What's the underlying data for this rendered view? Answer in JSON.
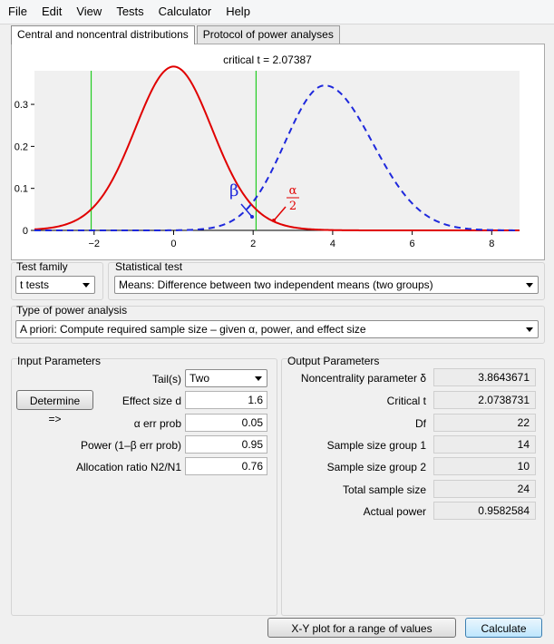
{
  "menu": [
    "File",
    "Edit",
    "View",
    "Tests",
    "Calculator",
    "Help"
  ],
  "tabs": {
    "central": "Central and noncentral distributions",
    "protocol": "Protocol of power analyses"
  },
  "chart_data": {
    "type": "line",
    "title": "critical t = 2.07387",
    "xlim": [
      -3.5,
      8.7
    ],
    "ylim": [
      0,
      0.38
    ],
    "x_ticks": [
      -2,
      0,
      2,
      4,
      6,
      8
    ],
    "y_ticks": [
      0,
      0.1,
      0.2,
      0.3
    ],
    "y_tick_labels": [
      "0",
      "0.1",
      "0.2",
      "0.3"
    ],
    "critical_lines": [
      -2.07387,
      2.07387
    ],
    "noncentrality": 3.8643671,
    "series": [
      {
        "style": "solid",
        "color": "#e00000",
        "peak": 0.39,
        "center": 0
      },
      {
        "style": "dashed",
        "color": "#1e28dc",
        "peak": 0.345,
        "center": 3.8
      }
    ],
    "annotations": {
      "beta": "β",
      "alpha_num": "α",
      "alpha_den": "2"
    },
    "colors": {
      "central": "#e00000",
      "noncentral": "#1e28dc",
      "critical": "#22cc22"
    }
  },
  "test_family": {
    "label": "Test family",
    "value": "t tests"
  },
  "statistical_test": {
    "label": "Statistical test",
    "value": "Means: Difference between two independent means (two groups)"
  },
  "power_analysis": {
    "label": "Type of power analysis",
    "value": "A priori: Compute required sample size – given α, power, and effect size"
  },
  "input": {
    "title": "Input Parameters",
    "tails_label": "Tail(s)",
    "tails_value": "Two",
    "determine": "Determine =>",
    "effect_label": "Effect size d",
    "effect_value": "1.6",
    "alpha_label": "α err prob",
    "alpha_value": "0.05",
    "power_label": "Power (1–β err prob)",
    "power_value": "0.95",
    "ratio_label": "Allocation ratio N2/N1",
    "ratio_value": "0.76"
  },
  "output": {
    "title": "Output Parameters",
    "rows": [
      {
        "label": "Noncentrality parameter δ",
        "value": "3.8643671"
      },
      {
        "label": "Critical t",
        "value": "2.0738731"
      },
      {
        "label": "Df",
        "value": "22"
      },
      {
        "label": "Sample size group 1",
        "value": "14"
      },
      {
        "label": "Sample size group 2",
        "value": "10"
      },
      {
        "label": "Total sample size",
        "value": "24"
      },
      {
        "label": "Actual power",
        "value": "0.9582584"
      }
    ]
  },
  "buttons": {
    "xy_plot": "X-Y plot for a range of values",
    "calculate": "Calculate"
  }
}
